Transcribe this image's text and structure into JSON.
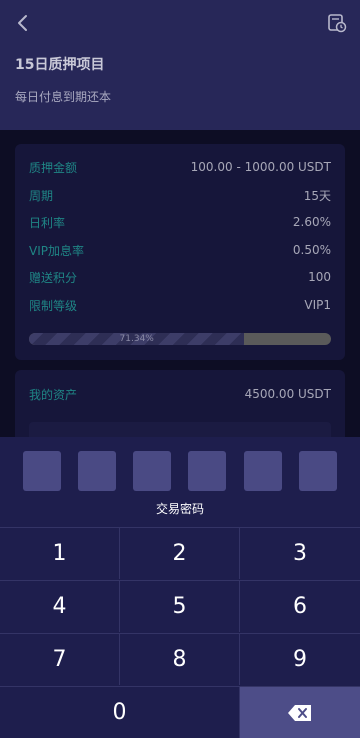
{
  "header": {
    "title": "15日质押项目",
    "subtitle": "每日付息到期还本"
  },
  "details": [
    {
      "label": "质押金额",
      "value": "100.00 - 1000.00 USDT"
    },
    {
      "label": "周期",
      "value": "15天"
    },
    {
      "label": "日利率",
      "value": "2.60%"
    },
    {
      "label": "VIP加息率",
      "value": "0.50%"
    },
    {
      "label": "赠送积分",
      "value": "100"
    },
    {
      "label": "限制等级",
      "value": "VIP1"
    }
  ],
  "progress": {
    "text": "71.34%",
    "value": 71.34
  },
  "assets": {
    "label": "我的资产",
    "value": "4500.00 USDT"
  },
  "pin": {
    "label": "交易密码",
    "length": 6
  },
  "keypad": {
    "keys": [
      "1",
      "2",
      "3",
      "4",
      "5",
      "6",
      "7",
      "8",
      "9",
      "0"
    ]
  },
  "colors": {
    "header_bg": "#272758",
    "label_teal": "#1f8585",
    "keypad_bg": "#1e1e4d",
    "pin_box": "#4a4a84",
    "delete_key": "#4d4d88"
  }
}
